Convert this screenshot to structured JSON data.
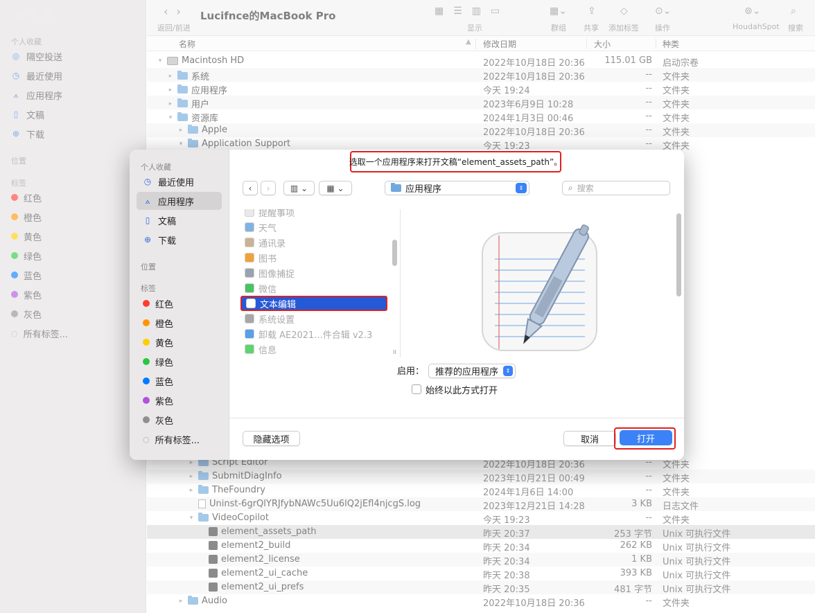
{
  "finder": {
    "window_title": "Lucifnce的MacBook Pro",
    "toolbar": {
      "back_forward": "返回/前进",
      "view": "显示",
      "group": "群组",
      "share": "共享",
      "add_tag": "添加标签",
      "action": "操作",
      "houdahspot": "HoudahSpot",
      "search": "搜索"
    },
    "sidebar": {
      "favorites_title": "个人收藏",
      "favorites": [
        "隔空投送",
        "最近使用",
        "应用程序",
        "文稿",
        "下载"
      ],
      "locations_title": "位置",
      "tags_title": "标签",
      "tags": [
        "红色",
        "橙色",
        "黄色",
        "绿色",
        "蓝色",
        "紫色",
        "灰色",
        "所有标签..."
      ]
    },
    "columns": {
      "name": "名称",
      "date": "修改日期",
      "size": "大小",
      "kind": "种类"
    },
    "rows": [
      {
        "name": "Macintosh HD",
        "date": "2022年10月18日 20:36",
        "size": "115.01 GB",
        "kind": "启动宗卷",
        "level": 0,
        "icon": "disk",
        "tri": "▾"
      },
      {
        "name": "系统",
        "date": "2022年10月18日 20:36",
        "size": "--",
        "kind": "文件夹",
        "level": 1,
        "icon": "folder",
        "tri": "▸"
      },
      {
        "name": "应用程序",
        "date": "今天 19:24",
        "size": "--",
        "kind": "文件夹",
        "level": 1,
        "icon": "folder",
        "tri": "▸"
      },
      {
        "name": "用户",
        "date": "2023年6月9日 10:28",
        "size": "--",
        "kind": "文件夹",
        "level": 1,
        "icon": "folder",
        "tri": "▸"
      },
      {
        "name": "资源库",
        "date": "2024年1月3日 00:46",
        "size": "--",
        "kind": "文件夹",
        "level": 1,
        "icon": "folder",
        "tri": "▾"
      },
      {
        "name": "Apple",
        "date": "2022年10月18日 20:36",
        "size": "--",
        "kind": "文件夹",
        "level": 2,
        "icon": "folder",
        "tri": "▸"
      },
      {
        "name": "Application Support",
        "date": "今天 19:23",
        "size": "--",
        "kind": "文件夹",
        "level": 2,
        "icon": "folder",
        "tri": "▾"
      }
    ],
    "rows_bottom": [
      {
        "name": "Script Editor",
        "date": "2022年10月18日 20:36",
        "size": "--",
        "kind": "文件夹",
        "level": 3,
        "icon": "folder",
        "tri": "▸"
      },
      {
        "name": "SubmitDiagInfo",
        "date": "2023年10月21日 00:49",
        "size": "--",
        "kind": "文件夹",
        "level": 3,
        "icon": "folder",
        "tri": "▸"
      },
      {
        "name": "TheFoundry",
        "date": "2024年1月6日 14:00",
        "size": "--",
        "kind": "文件夹",
        "level": 3,
        "icon": "folder",
        "tri": "▸"
      },
      {
        "name": "Uninst-6grQlYRJfybNAWc5Uu6lQ2jEfl4njcgS.log",
        "date": "2023年12月21日 14:28",
        "size": "3 KB",
        "kind": "日志文件",
        "level": 3,
        "icon": "file",
        "tri": ""
      },
      {
        "name": "VideoCopilot",
        "date": "今天 19:23",
        "size": "--",
        "kind": "文件夹",
        "level": 3,
        "icon": "folder",
        "tri": "▾"
      },
      {
        "name": "element_assets_path",
        "date": "昨天 20:37",
        "size": "253 字节",
        "kind": "Unix 可执行文件",
        "level": 4,
        "icon": "exe",
        "tri": "",
        "selected": true
      },
      {
        "name": "element2_build",
        "date": "昨天 20:34",
        "size": "262 KB",
        "kind": "Unix 可执行文件",
        "level": 4,
        "icon": "exe",
        "tri": ""
      },
      {
        "name": "element2_license",
        "date": "昨天 20:34",
        "size": "1 KB",
        "kind": "Unix 可执行文件",
        "level": 4,
        "icon": "exe",
        "tri": ""
      },
      {
        "name": "element2_ui_cache",
        "date": "昨天 20:38",
        "size": "393 KB",
        "kind": "Unix 可执行文件",
        "level": 4,
        "icon": "exe",
        "tri": ""
      },
      {
        "name": "element2_ui_prefs",
        "date": "昨天 20:35",
        "size": "481 字节",
        "kind": "Unix 可执行文件",
        "level": 4,
        "icon": "exe",
        "tri": ""
      },
      {
        "name": "Audio",
        "date": "2022年10月18日 20:36",
        "size": "--",
        "kind": "文件夹",
        "level": 2,
        "icon": "folder",
        "tri": "▸"
      }
    ]
  },
  "dialog": {
    "message": "选取一个应用程序来打开文稿“element_assets_path”。",
    "sidebar": {
      "favorites_title": "个人收藏",
      "favorites": [
        "最近使用",
        "应用程序",
        "文稿",
        "下载"
      ],
      "locations_title": "位置",
      "tags_title": "标签",
      "tags": [
        "红色",
        "橙色",
        "黄色",
        "绿色",
        "蓝色",
        "紫色",
        "灰色",
        "所有标签..."
      ]
    },
    "location": "应用程序",
    "search_placeholder": "搜索",
    "apps": [
      "提醒事项",
      "天气",
      "通讯录",
      "图书",
      "图像捕捉",
      "微信",
      "文本编辑",
      "系统设置",
      "卸载 AE2021...件合辑 v2.3",
      "信息"
    ],
    "selected_app": "文本编辑",
    "enable_label": "启用：",
    "enable_value": "推荐的应用程序",
    "always_open": "始终以此方式打开",
    "hide_options": "隐藏选项",
    "cancel": "取消",
    "open": "打开"
  },
  "colors": {
    "accent": "#3b82f6",
    "highlight_frame": "#e02020",
    "tag_colors": [
      "#ff3b30",
      "#ff9500",
      "#ffcc00",
      "#28c840",
      "#007aff",
      "#af52de",
      "#8e8e93"
    ]
  }
}
